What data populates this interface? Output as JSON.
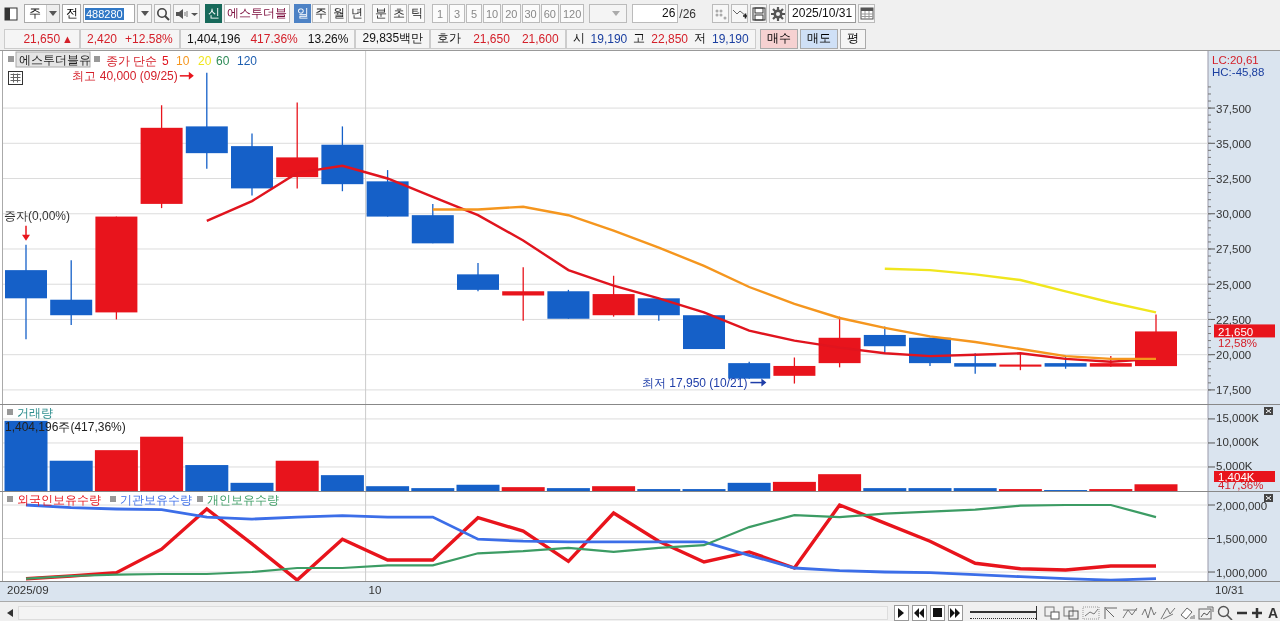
{
  "toolbar": {
    "market": "주",
    "prefix": "전",
    "code": "488280",
    "badge": "신",
    "name": "에스투더블",
    "periods": [
      {
        "label": "일",
        "selected": true
      },
      {
        "label": "주",
        "selected": false
      },
      {
        "label": "월",
        "selected": false
      },
      {
        "label": "년",
        "selected": false
      },
      {
        "label": "분",
        "selected": false
      },
      {
        "label": "초",
        "selected": false
      },
      {
        "label": "틱",
        "selected": false
      }
    ],
    "intervals": [
      {
        "label": "1",
        "disabled": true
      },
      {
        "label": "3",
        "disabled": true
      },
      {
        "label": "5",
        "disabled": true
      },
      {
        "label": "10",
        "disabled": true
      },
      {
        "label": "20",
        "disabled": true
      },
      {
        "label": "30",
        "disabled": true
      },
      {
        "label": "60",
        "disabled": true
      },
      {
        "label": "120",
        "disabled": true
      }
    ],
    "count": "26",
    "total": "/26",
    "date": "2025/10/31"
  },
  "quote_bar": {
    "price": "21,650",
    "arrow": "▲",
    "change": "2,420",
    "change_rate": "+12.58%",
    "volume": "1,404,196",
    "volume_rate": "417.36%",
    "turnover": "13.26%",
    "amount": "29,835백만",
    "ask_label": "호가",
    "ask": "21,650",
    "bid": "21,600",
    "open_label": "시",
    "open": "19,190",
    "high_label": "고",
    "high": "22,850",
    "low_label": "저",
    "low": "19,190",
    "buttons": [
      {
        "label": "매수",
        "kind": "buy"
      },
      {
        "label": "매도",
        "kind": "sell"
      },
      {
        "label": "평",
        "kind": "plain"
      }
    ]
  },
  "price_panel": {
    "stock_name": "에스투더블유",
    "indicator": "종가 단순",
    "lc": "LC:20,61",
    "hc": "HC:-45,88",
    "price_tag": "21,650",
    "change_tag": "12,58%",
    "extra_periods": [
      {
        "label": "60",
        "color": "#2e8b57"
      },
      {
        "label": "120",
        "color": "#1f5fb0"
      }
    ],
    "chart_data": {
      "type": "line",
      "grid": true,
      "ylim": [
        16500,
        41550
      ],
      "categories": [
        null,
        null,
        null,
        null,
        null,
        null,
        null,
        null,
        null,
        null,
        null,
        null,
        null,
        null,
        null,
        null,
        null,
        null,
        null,
        null,
        null,
        null,
        null,
        null,
        null,
        null
      ],
      "yticks": [
        {
          "value": 17500,
          "label": "17,500"
        },
        {
          "value": 20000,
          "label": "20,000"
        },
        {
          "value": 22500,
          "label": "22,500"
        },
        {
          "value": 25000,
          "label": "25,000"
        },
        {
          "value": 27500,
          "label": "27,500"
        },
        {
          "value": 30000,
          "label": "30,000"
        },
        {
          "value": 32500,
          "label": "32,500"
        },
        {
          "value": 35000,
          "label": "35,000"
        },
        {
          "value": 37500,
          "label": "37,500"
        }
      ],
      "series": [
        {
          "name": "5",
          "color": "#e0141e",
          "values": [
            null,
            null,
            null,
            null,
            29500,
            30900,
            32900,
            33400,
            32500,
            31200,
            29900,
            28100,
            26000,
            24900,
            24000,
            23000,
            21700,
            21000,
            20500,
            20100,
            19900,
            20000,
            20100,
            19700,
            19500,
            19700
          ]
        },
        {
          "name": "10",
          "color": "#f5961e",
          "values": [
            null,
            null,
            null,
            null,
            null,
            null,
            null,
            null,
            null,
            30300,
            30300,
            30500,
            29900,
            28800,
            27600,
            26300,
            24800,
            23600,
            22600,
            21900,
            21300,
            20900,
            20400,
            19900,
            19700,
            19700
          ]
        },
        {
          "name": "20",
          "color": "#f0e61e",
          "values": [
            null,
            null,
            null,
            null,
            null,
            null,
            null,
            null,
            null,
            null,
            null,
            null,
            null,
            null,
            null,
            null,
            null,
            null,
            null,
            26100,
            26000,
            25700,
            25300,
            24500,
            23700,
            23000
          ]
        }
      ],
      "annotations": [
        "증자(0,00%)",
        "최고 40,000 (09/25)",
        "최저 17,950 (10/21)"
      ]
    }
  },
  "volume_panel": {
    "reading": "1,404,196주(417,36%)",
    "tag": "1,404K",
    "tag_percent": "417,36%",
    "chart_data": {
      "type": "bar",
      "grid": true,
      "ylim": [
        0,
        17900
      ],
      "categories": [
        null,
        null,
        null,
        null,
        null,
        null,
        null,
        null,
        null,
        null,
        null,
        null,
        null,
        null,
        null,
        null,
        null,
        null,
        null,
        null,
        null,
        null,
        null,
        null,
        null,
        null
      ],
      "yticks": [
        {
          "value": 5000,
          "label": "5,000K"
        },
        {
          "value": 10000,
          "label": "10,000K"
        },
        {
          "value": 15000,
          "label": "15,000K"
        }
      ],
      "series": [
        {
          "name": "거래량",
          "values": [
            14600,
            6300,
            8500,
            11300,
            5400,
            1700,
            6300,
            3300,
            1000,
            600,
            1300,
            800,
            600,
            1000,
            400,
            400,
            1700,
            1900,
            3500,
            600,
            600,
            600,
            400,
            200,
            400,
            1400
          ]
        }
      ]
    }
  },
  "holdings_panel": {
    "end_date": "10/31",
    "chart_data": {
      "type": "line",
      "grid": true,
      "ylim": [
        866000,
        2194000
      ],
      "categories": [
        "2025/09",
        null,
        null,
        null,
        null,
        null,
        null,
        null,
        "10",
        null,
        null,
        null,
        null,
        null,
        null,
        null,
        null,
        null,
        null,
        null,
        null,
        null,
        null,
        null,
        null,
        null
      ],
      "yticks": [
        {
          "value": 1000000,
          "label": "1,000,000"
        },
        {
          "value": 1500000,
          "label": "1,500,000"
        },
        {
          "value": 2000000,
          "label": "2,000,000"
        }
      ],
      "series": [
        {
          "name": "외국인보유수량",
          "color": "#e8141c",
          "values": [
            900000,
            940000,
            990000,
            1340000,
            1940000,
            1420000,
            880000,
            1490000,
            1180000,
            1180000,
            1810000,
            1610000,
            1160000,
            1880000,
            1460000,
            1150000,
            1300000,
            1060000,
            2000000,
            1730000,
            1460000,
            1130000,
            1050000,
            1030000,
            1090000,
            1090000
          ]
        },
        {
          "name": "기관보유수량",
          "color": "#3c6ee8",
          "values": [
            2000000,
            1960000,
            1940000,
            1930000,
            1820000,
            1790000,
            1820000,
            1840000,
            1820000,
            1820000,
            1490000,
            1460000,
            1450000,
            1450000,
            1450000,
            1450000,
            1250000,
            1060000,
            1020000,
            1000000,
            990000,
            960000,
            930000,
            900000,
            880000,
            900000
          ]
        },
        {
          "name": "개인보유수량",
          "color": "#3c9c64",
          "values": [
            900000,
            940000,
            960000,
            970000,
            970000,
            1000000,
            1060000,
            1060000,
            1100000,
            1100000,
            1280000,
            1310000,
            1360000,
            1300000,
            1360000,
            1400000,
            1670000,
            1850000,
            1820000,
            1870000,
            1900000,
            1930000,
            1990000,
            2000000,
            2000000,
            1820000
          ]
        }
      ]
    }
  },
  "bottom_bar": {
    "zoom_slider": {
      "level": 1
    },
    "font_button": "A"
  }
}
